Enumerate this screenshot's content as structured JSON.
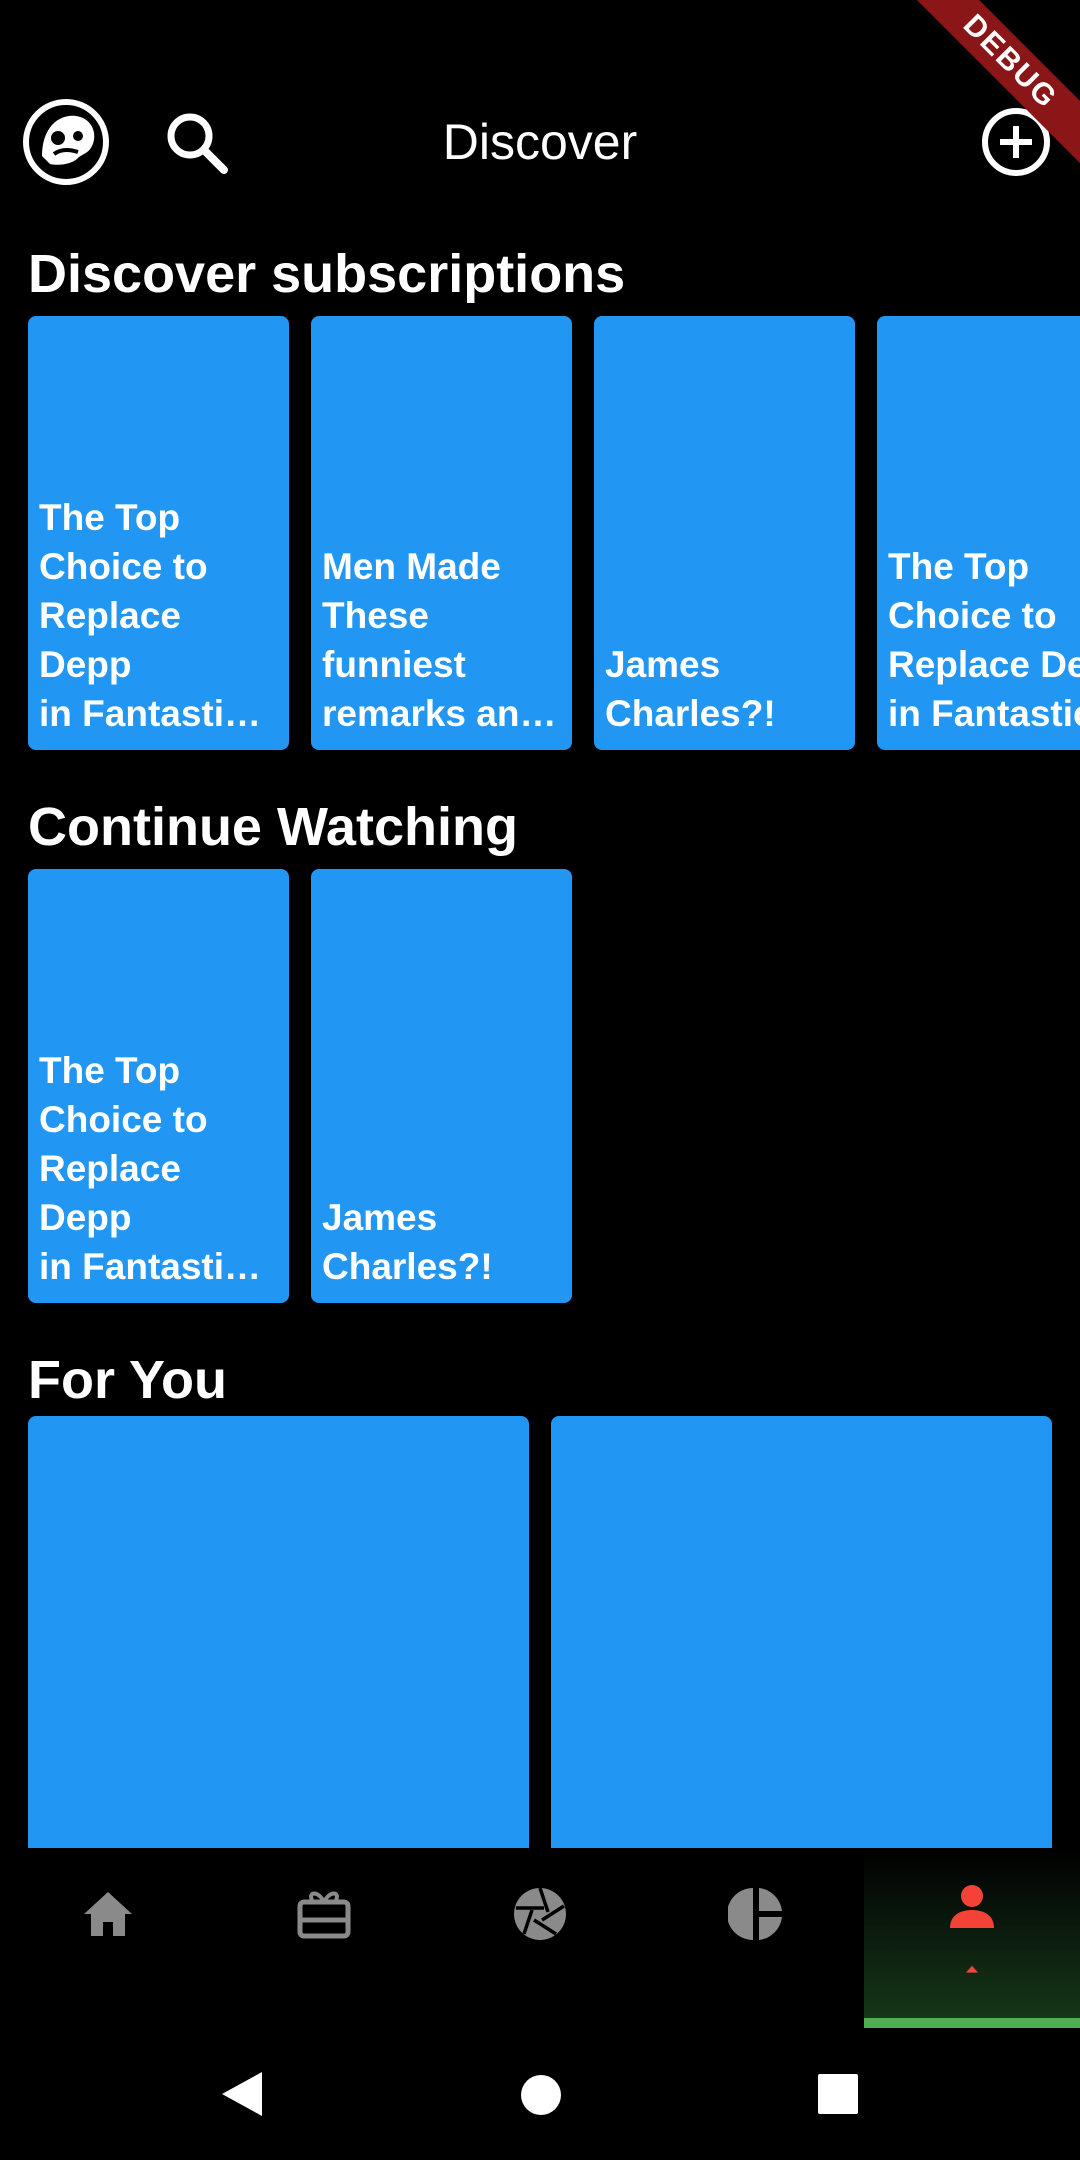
{
  "header": {
    "title": "Discover",
    "debug_banner": "DEBUG"
  },
  "sections": {
    "subscriptions": {
      "title": "Discover subscriptions",
      "cards": [
        {
          "lines": [
            "The Top",
            "Choice to",
            "Replace Depp",
            "in Fantastic …"
          ]
        },
        {
          "lines": [
            "Men Made",
            "These",
            "funniest",
            "remarks an…"
          ]
        },
        {
          "lines": [
            "James",
            "Charles?!"
          ]
        },
        {
          "lines": [
            "The Top",
            "Choice to",
            "Replace Depp",
            "in Fantastic …"
          ]
        }
      ]
    },
    "continue_watching": {
      "title": "Continue Watching",
      "cards": [
        {
          "lines": [
            "The Top",
            "Choice to",
            "Replace Depp",
            "in Fantastic …"
          ]
        },
        {
          "lines": [
            "James",
            "Charles?!"
          ]
        }
      ]
    },
    "for_you": {
      "title": "For You"
    }
  },
  "bottom_nav": {
    "items": [
      {
        "icon": "home-icon"
      },
      {
        "icon": "gift-card-icon"
      },
      {
        "icon": "camera-aperture-icon"
      },
      {
        "icon": "pie-chart-icon"
      },
      {
        "icon": "person-icon",
        "active": true
      }
    ],
    "accent_color": "#f44336",
    "indicator_color": "#4caf50"
  },
  "colors": {
    "card": "#2196f3",
    "background": "#000000"
  }
}
